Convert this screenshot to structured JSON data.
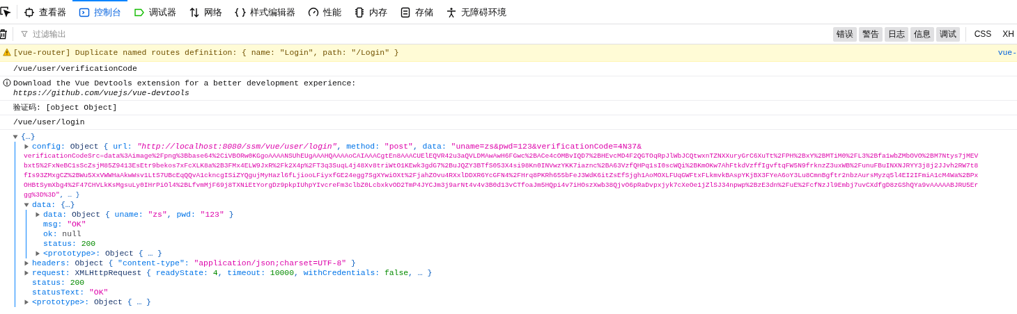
{
  "toolbar": {
    "tabs": [
      {
        "label": "查看器",
        "selected": false
      },
      {
        "label": "控制台",
        "selected": true
      },
      {
        "label": "调试器",
        "selected": false
      },
      {
        "label": "网络",
        "selected": false
      },
      {
        "label": "样式编辑器",
        "selected": false
      },
      {
        "label": "性能",
        "selected": false
      },
      {
        "label": "内存",
        "selected": false
      },
      {
        "label": "存储",
        "selected": false
      },
      {
        "label": "无障碍环境",
        "selected": false
      }
    ]
  },
  "filter_bar": {
    "placeholder": "过滤输出",
    "filters": [
      {
        "label": "错误",
        "on": true
      },
      {
        "label": "警告",
        "on": true
      },
      {
        "label": "日志",
        "on": true
      },
      {
        "label": "信息",
        "on": true
      },
      {
        "label": "调试",
        "on": true
      }
    ],
    "requests": [
      {
        "label": "CSS",
        "on": false
      },
      {
        "label": "XH",
        "on": false
      }
    ]
  },
  "messages": [
    {
      "kind": "warning",
      "text": "[vue-router] Duplicate named routes definition: { name: \"Login\", path: \"/Login\" }",
      "source": "vue-"
    },
    {
      "kind": "log",
      "text": "/vue/user/verificationCode"
    },
    {
      "kind": "info",
      "text": "Download the Vue Devtools extension for a better development experience:",
      "link": "https://github.com/vuejs/vue-devtools"
    },
    {
      "kind": "log",
      "text": "验证码: [object Object]"
    },
    {
      "kind": "log",
      "text": "/vue/user/login"
    },
    {
      "kind": "object",
      "tree": {
        "kind": "expandable",
        "expanded": true,
        "lines": [
          [
            {
              "kind": "punct",
              "text": "{…}"
            }
          ]
        ],
        "children": [
          {
            "kind": "expandable",
            "expanded": false,
            "lines": [
              [
                {
                  "kind": "key",
                  "text": "config: "
                },
                {
                  "kind": "type",
                  "text": "Object "
                },
                {
                  "kind": "punct",
                  "text": "{ "
                },
                {
                  "kind": "key",
                  "text": "url: "
                },
                {
                  "kind": "url",
                  "text": "\"http://localhost:8080/ssm/vue/user/login\""
                },
                {
                  "kind": "punct",
                  "text": ", "
                },
                {
                  "kind": "key",
                  "text": "method: "
                },
                {
                  "kind": "string",
                  "text": "\"post\""
                },
                {
                  "kind": "punct",
                  "text": ", "
                },
                {
                  "kind": "key",
                  "text": "data: "
                },
                {
                  "kind": "string",
                  "text": "\"uname=zs&pwd=123&verificationCode=4N37&"
                }
              ],
              [
                {
                  "kind": "string",
                  "text": "verificationCodeSrc=data%3Aimage%2Fpng%3Bbase64%2CiVBORw0KGgoAAAANSUhEUgAAAHQAAAAoCAIAAACgtEn8AAACUElEQVR42u3aQVLDMAwAwH6FGwc%2BACe4cOMBvIQD7%2BHEvcMD4F2QGTOqRpJlWbJCQtwxnTZNXXuryGrC6XuTt%2FPH%2BxY%2BMTiM0%2FL3%2Bfa1wbZMbOVO%2BM7Ntys7jMEV"
                }
              ],
              [
                {
                  "kind": "string",
                  "text": "bxt5%2FxNeBC1sScZsjM85Z9413EsEtr9bekos7xFcXLK8a%2B3FMx4ELW9JxR%2Fk2X4p%2FT3q3SuqL4j48Xv8triWtO1KEwk3gdG7%2BuJQZY3BTfS053X4si98Kn0INVwzYKK7iaznc%2BA63VzfQHPq1sI0scWQi%2BKmOKw7AhFtkdVzffIgvftqFW5N9frknzZ3uxWB%2FunuFBuINXNJRYY3j8j2JJvh2RW7t8"
                }
              ],
              [
                {
                  "kind": "string",
                  "text": "fIs93ZMxgCZ%2BWu5XxVWWHaAkwWsv1LtS7UBcEqQQvA1ckncgISiZYQgujMyHazl6fLjiooLFiyxfGE24egg7SgXYwiOXt%2FjahZOvu4RXxlDDXR6YcGFN4%2FHrq8PKRh655bFeJ3WdK6itZsEfSjgh1AoMOXLFUqGWFtxFLkmvkBAspYKjBX3FYeA6oY3Lu8CmnBgftr2nbzAursMyzq5l4EI2IFmiA1cM4Wa%2BPx"
                }
              ],
              [
                {
                  "kind": "string",
                  "text": "OHBtSymXbg4%2F47CHVLkKsMgsuLy0IHrPiOl4%2BLfvmMjF69j8TXNiEtYorgDz9pkpIUhpYIvcreFm3clbZ0LcbxkvOD2TmP4JYCJm3j9arNt4v4v3B0d13vCTfoaJm5HQpi4v7iHOszXwb38QjvO6pRaDvpxjyk7cXeOe1jZlSJ34npwp%2BzE3dn%2FuE%2FcfNzJl9Embj7uvCXdfgD8zGShQYa9vAAAAABJRU5Er"
                }
              ],
              [
                {
                  "kind": "string",
                  "text": "gg%3D%3D\""
                },
                {
                  "kind": "punct",
                  "text": ", … }"
                }
              ]
            ]
          },
          {
            "kind": "expandable",
            "expanded": true,
            "lines": [
              [
                {
                  "kind": "key",
                  "text": "data: "
                },
                {
                  "kind": "punct",
                  "text": "{…}"
                }
              ]
            ],
            "children": [
              {
                "kind": "expandable",
                "expanded": false,
                "lines": [
                  [
                    {
                      "kind": "key",
                      "text": "data: "
                    },
                    {
                      "kind": "type",
                      "text": "Object "
                    },
                    {
                      "kind": "punct",
                      "text": "{ "
                    },
                    {
                      "kind": "key",
                      "text": "uname: "
                    },
                    {
                      "kind": "string",
                      "text": "\"zs\""
                    },
                    {
                      "kind": "punct",
                      "text": ", "
                    },
                    {
                      "kind": "key",
                      "text": "pwd: "
                    },
                    {
                      "kind": "string",
                      "text": "\"123\""
                    },
                    {
                      "kind": "punct",
                      "text": " }"
                    }
                  ]
                ]
              },
              {
                "kind": "leaf",
                "lines": [
                  [
                    {
                      "kind": "key",
                      "text": "msg: "
                    },
                    {
                      "kind": "string",
                      "text": "\"OK\""
                    }
                  ]
                ]
              },
              {
                "kind": "leaf",
                "lines": [
                  [
                    {
                      "kind": "key",
                      "text": "ok: "
                    },
                    {
                      "kind": "null",
                      "text": "null"
                    }
                  ]
                ]
              },
              {
                "kind": "leaf",
                "lines": [
                  [
                    {
                      "kind": "key",
                      "text": "status: "
                    },
                    {
                      "kind": "number",
                      "text": "200"
                    }
                  ]
                ]
              },
              {
                "kind": "expandable",
                "expanded": false,
                "lines": [
                  [
                    {
                      "kind": "key",
                      "text": "<prototype>: "
                    },
                    {
                      "kind": "type",
                      "text": "Object "
                    },
                    {
                      "kind": "punct",
                      "text": "{ … }"
                    }
                  ]
                ]
              }
            ]
          },
          {
            "kind": "expandable",
            "expanded": false,
            "lines": [
              [
                {
                  "kind": "key",
                  "text": "headers: "
                },
                {
                  "kind": "type",
                  "text": "Object "
                },
                {
                  "kind": "punct",
                  "text": "{ "
                },
                {
                  "kind": "key",
                  "text": "\"content-type\": "
                },
                {
                  "kind": "string",
                  "text": "\"application/json;charset=UTF-8\""
                },
                {
                  "kind": "punct",
                  "text": " }"
                }
              ]
            ]
          },
          {
            "kind": "expandable",
            "expanded": false,
            "lines": [
              [
                {
                  "kind": "key",
                  "text": "request: "
                },
                {
                  "kind": "type",
                  "text": "XMLHttpRequest "
                },
                {
                  "kind": "punct",
                  "text": "{ "
                },
                {
                  "kind": "key",
                  "text": "readyState: "
                },
                {
                  "kind": "number",
                  "text": "4"
                },
                {
                  "kind": "punct",
                  "text": ", "
                },
                {
                  "kind": "key",
                  "text": "timeout: "
                },
                {
                  "kind": "number",
                  "text": "10000"
                },
                {
                  "kind": "punct",
                  "text": ", "
                },
                {
                  "kind": "key",
                  "text": "withCredentials: "
                },
                {
                  "kind": "number",
                  "text": "false"
                },
                {
                  "kind": "punct",
                  "text": ", … }"
                }
              ]
            ]
          },
          {
            "kind": "leaf",
            "lines": [
              [
                {
                  "kind": "key",
                  "text": "status: "
                },
                {
                  "kind": "number",
                  "text": "200"
                }
              ]
            ]
          },
          {
            "kind": "leaf",
            "lines": [
              [
                {
                  "kind": "key",
                  "text": "statusText: "
                },
                {
                  "kind": "string",
                  "text": "\"OK\""
                }
              ]
            ]
          },
          {
            "kind": "expandable",
            "expanded": false,
            "lines": [
              [
                {
                  "kind": "key",
                  "text": "<prototype>: "
                },
                {
                  "kind": "type",
                  "text": "Object "
                },
                {
                  "kind": "punct",
                  "text": "{ … }"
                }
              ]
            ]
          }
        ]
      }
    }
  ]
}
